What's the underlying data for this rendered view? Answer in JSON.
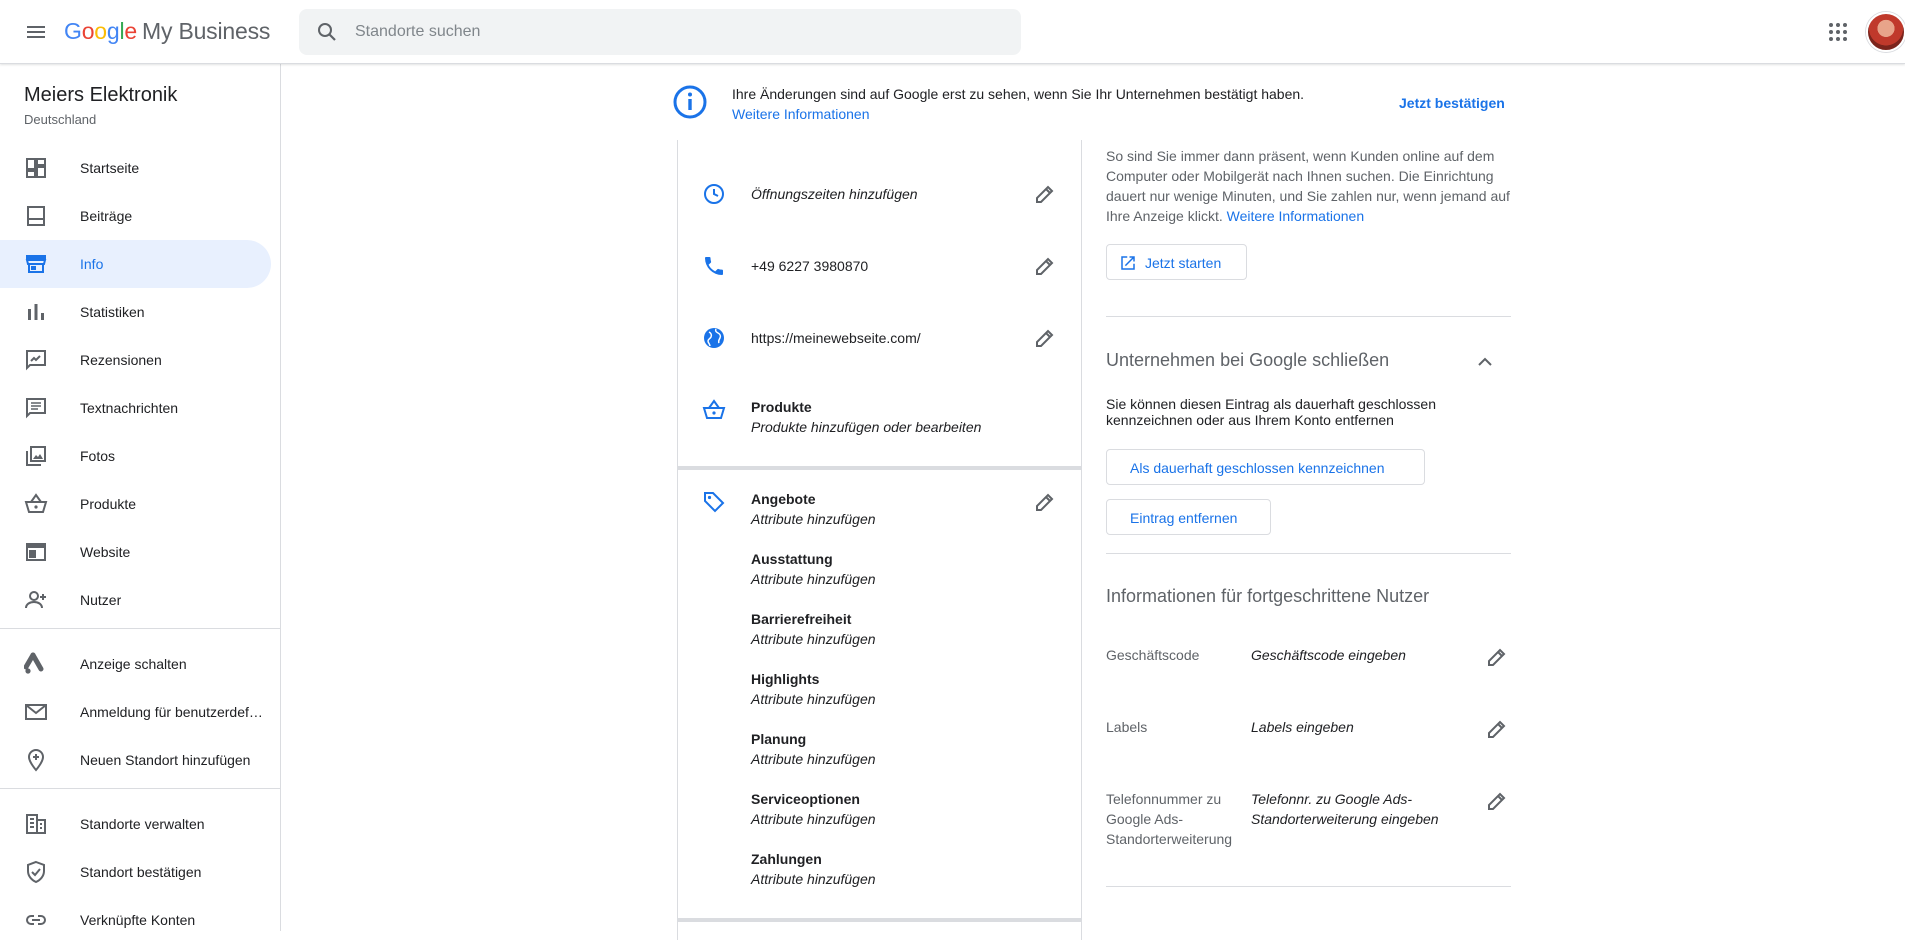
{
  "header": {
    "logo_google": [
      "G",
      "o",
      "o",
      "g",
      "l",
      "e"
    ],
    "logo_product": "My Business",
    "search_placeholder": "Standorte suchen"
  },
  "sidebar": {
    "business_name": "Meiers Elektronik",
    "country": "Deutschland",
    "items": [
      {
        "label": "Startseite",
        "icon": "dashboard-icon"
      },
      {
        "label": "Beiträge",
        "icon": "posts-icon"
      },
      {
        "label": "Info",
        "icon": "store-icon",
        "active": true
      },
      {
        "label": "Statistiken",
        "icon": "bar-chart-icon"
      },
      {
        "label": "Rezensionen",
        "icon": "reviews-icon"
      },
      {
        "label": "Textnachrichten",
        "icon": "message-icon"
      },
      {
        "label": "Fotos",
        "icon": "photos-icon"
      },
      {
        "label": "Produkte",
        "icon": "basket-icon"
      },
      {
        "label": "Website",
        "icon": "web-icon"
      },
      {
        "label": "Nutzer",
        "icon": "person-add-icon"
      },
      {
        "label": "Anzeige schalten",
        "icon": "google-ads-icon"
      },
      {
        "label": "Anmeldung für benutzerdefinierte E-Mail-Adressen",
        "icon": "mail-icon"
      },
      {
        "label": "Neuen Standort hinzufügen",
        "icon": "add-location-icon"
      },
      {
        "label": "Standorte verwalten",
        "icon": "building-icon"
      },
      {
        "label": "Standort bestätigen",
        "icon": "verified-shield-icon"
      },
      {
        "label": "Verknüpfte Konten",
        "icon": "link-icon"
      }
    ]
  },
  "banner": {
    "text": "Ihre Änderungen sind auf Google erst zu sehen, wenn Sie Ihr Unternehmen bestätigt haben.",
    "link": "Weitere Informationen",
    "confirm": "Jetzt bestätigen"
  },
  "info_card": {
    "hours": "Öffnungszeiten hinzufügen",
    "phone": "+49 6227 3980870",
    "website": "https://meinewebseite.com/",
    "products_title": "Produkte",
    "products_sub": "Produkte hinzufügen oder bearbeiten",
    "attributes": [
      {
        "title": "Angebote",
        "sub": "Attribute hinzufügen"
      },
      {
        "title": "Ausstattung",
        "sub": "Attribute hinzufügen"
      },
      {
        "title": "Barrierefreiheit",
        "sub": "Attribute hinzufügen"
      },
      {
        "title": "Highlights",
        "sub": "Attribute hinzufügen"
      },
      {
        "title": "Planung",
        "sub": "Attribute hinzufügen"
      },
      {
        "title": "Serviceoptionen",
        "sub": "Attribute hinzufügen"
      },
      {
        "title": "Zahlungen",
        "sub": "Attribute hinzufügen"
      }
    ]
  },
  "right_panel": {
    "ads_text": "So sind Sie immer dann präsent, wenn Kunden online auf dem Computer oder Mobilgerät nach Ihnen suchen. Die Einrichtung dauert nur wenige Minuten, und Sie zahlen nur, wenn jemand auf Ihre Anzeige klickt.",
    "ads_link": "Weitere Informationen",
    "ads_button": "Jetzt starten",
    "close_title": "Unternehmen bei Google schließen",
    "close_text": "Sie können diesen Eintrag als dauerhaft geschlossen kennzeichnen oder aus Ihrem Konto entfernen",
    "close_button": "Als dauerhaft geschlossen kennzeichnen",
    "remove_button": "Eintrag entfernen",
    "advanced_title": "Informationen für fortgeschrittene Nutzer",
    "advanced": [
      {
        "label": "Geschäftscode",
        "value": "Geschäftscode eingeben"
      },
      {
        "label": "Labels",
        "value": "Labels eingeben"
      },
      {
        "label": "Telefonnummer zu Google Ads-Standorterweiterung",
        "value": "Telefonnr. zu Google Ads-Standorterweiterung eingeben"
      }
    ]
  },
  "colors": {
    "accent": "#1a73e8",
    "active_bg": "#e8f0fe",
    "divider": "#dadce0",
    "icon": "#5f6368"
  }
}
